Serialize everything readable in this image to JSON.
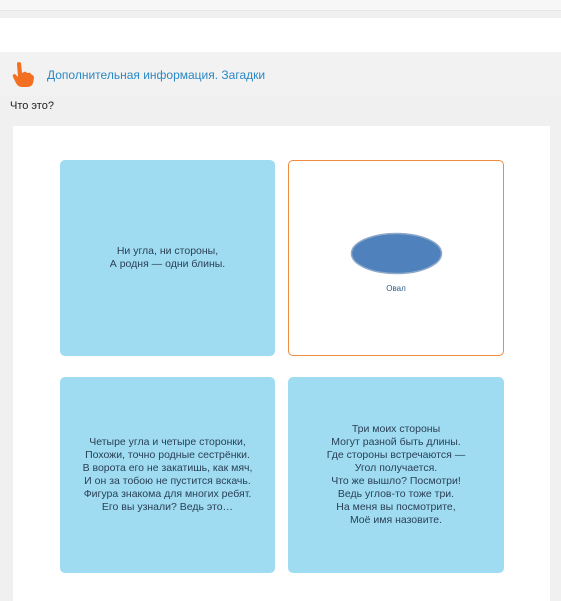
{
  "header": {
    "info_link": "Дополнительная информация. Загадки",
    "hand_icon": "pointing-hand-icon"
  },
  "question": "Что это?",
  "cards": [
    {
      "text": "Ни угла, ни стороны,\nА родня — одни блины.",
      "state": "unselected"
    },
    {
      "shape": "oval",
      "shape_color": "#4f81bd",
      "label": "Овал",
      "state": "selected"
    },
    {
      "text": "Четыре угла и четыре сторонки,\nПохожи, точно родные сестрёнки.\nВ ворота его не закатишь, как мяч,\nИ он за тобою не пустится вскачь.\nФигура знакома для многих ребят.\nЕго вы узнали? Ведь это…",
      "state": "unselected"
    },
    {
      "text": "Три моих стороны\nМогут разной быть длины.\nГде стороны встречаются —\nУгол получается.\nЧто же вышло? Посмотри!\nВедь углов-то тоже три.\nНа меня вы посмотрите,\nМоё имя назовите.",
      "state": "unselected"
    }
  ],
  "colors": {
    "card_blue": "#9fdcf1",
    "selected_border": "#f08a3e",
    "link": "#2a88c5",
    "hand_orange": "#f36f21"
  }
}
